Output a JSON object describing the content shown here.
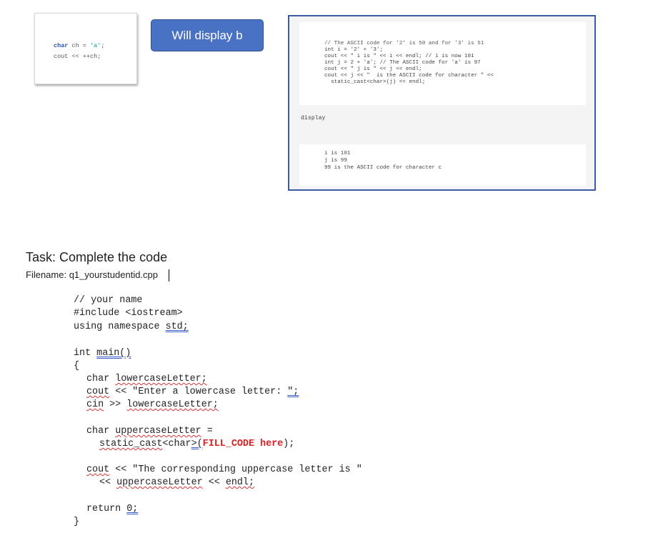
{
  "card1": {
    "line1_kw": "char",
    "line1_mid": " ch = ",
    "line1_str": "'a'",
    "line1_end": ";",
    "line2": "cout << ++ch;"
  },
  "button": {
    "label": "Will display b"
  },
  "panel": {
    "code_lines": [
      "// The ASCII code for '2' is 50 and for '3' is 51",
      "int i = '2' + '3';",
      "cout << \" i is \" << i << endl; // i is now 101",
      "int j = 2 + 'a'; // The ASCII code for 'a' is 97",
      "cout << \" j is \" << j << endl;",
      "cout << j << \"  is the ASCII code for character \" <<",
      "  static_cast<char>(j) << endl;"
    ],
    "display_label": "display",
    "output_lines": [
      "i is 101",
      "j is 99",
      "99 is the ASCII code for character c"
    ]
  },
  "task": {
    "title": "Task:  Complete the code",
    "filename": "Filename: q1_yourstudentid.cpp"
  },
  "code": {
    "l1": "// your name",
    "l2": "#include <iostream>",
    "l3a": "using namespace ",
    "l3b": "std;",
    "l4a": "int ",
    "l4b": "main()",
    "l5": "{",
    "l6a": "char ",
    "l6b": "lowercaseLetter;",
    "l7a": "cout",
    "l7b": " << \"Enter a lowercase letter: ",
    "l7c": "\";",
    "l8a": "cin",
    "l8b": " >> ",
    "l8c": "lowercaseLetter;",
    "l9a": "char ",
    "l9b": "uppercaseLetter",
    "l9c": " =",
    "l10a": "static_cast",
    "l10b": "<char",
    "l10c": ">(",
    "l10d": "FILL_CODE here",
    "l10e": ");",
    "l11a": "cout",
    "l11b": " << \"The corresponding uppercase letter is \"",
    "l12a": "<< ",
    "l12b": "uppercaseLetter",
    "l12c": " << ",
    "l12d": "endl;",
    "l13a": "return ",
    "l13b": "0;",
    "l14": "}"
  }
}
